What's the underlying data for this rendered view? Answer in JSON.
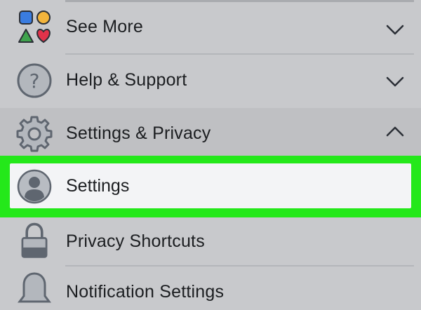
{
  "menu": {
    "see_more": {
      "label": "See More",
      "icon": "shapes-icon",
      "chevron": "chevron-down-icon"
    },
    "help_support": {
      "label": "Help & Support",
      "icon": "question-circle-icon",
      "chevron": "chevron-down-icon"
    },
    "settings_privacy": {
      "label": "Settings & Privacy",
      "icon": "gear-icon",
      "chevron": "chevron-up-icon"
    },
    "settings": {
      "label": "Settings",
      "icon": "user-avatar-icon",
      "highlighted": true
    },
    "privacy_shortcuts": {
      "label": "Privacy Shortcuts",
      "icon": "lock-icon"
    },
    "notification_settings": {
      "label": "Notification Settings",
      "icon": "bell-icon"
    }
  },
  "colors": {
    "highlight": "#24e81a",
    "background": "#c8c9cc",
    "selected_row": "#f3f4f6",
    "text": "#1c1e21",
    "icon_gray": "#5f6670"
  }
}
